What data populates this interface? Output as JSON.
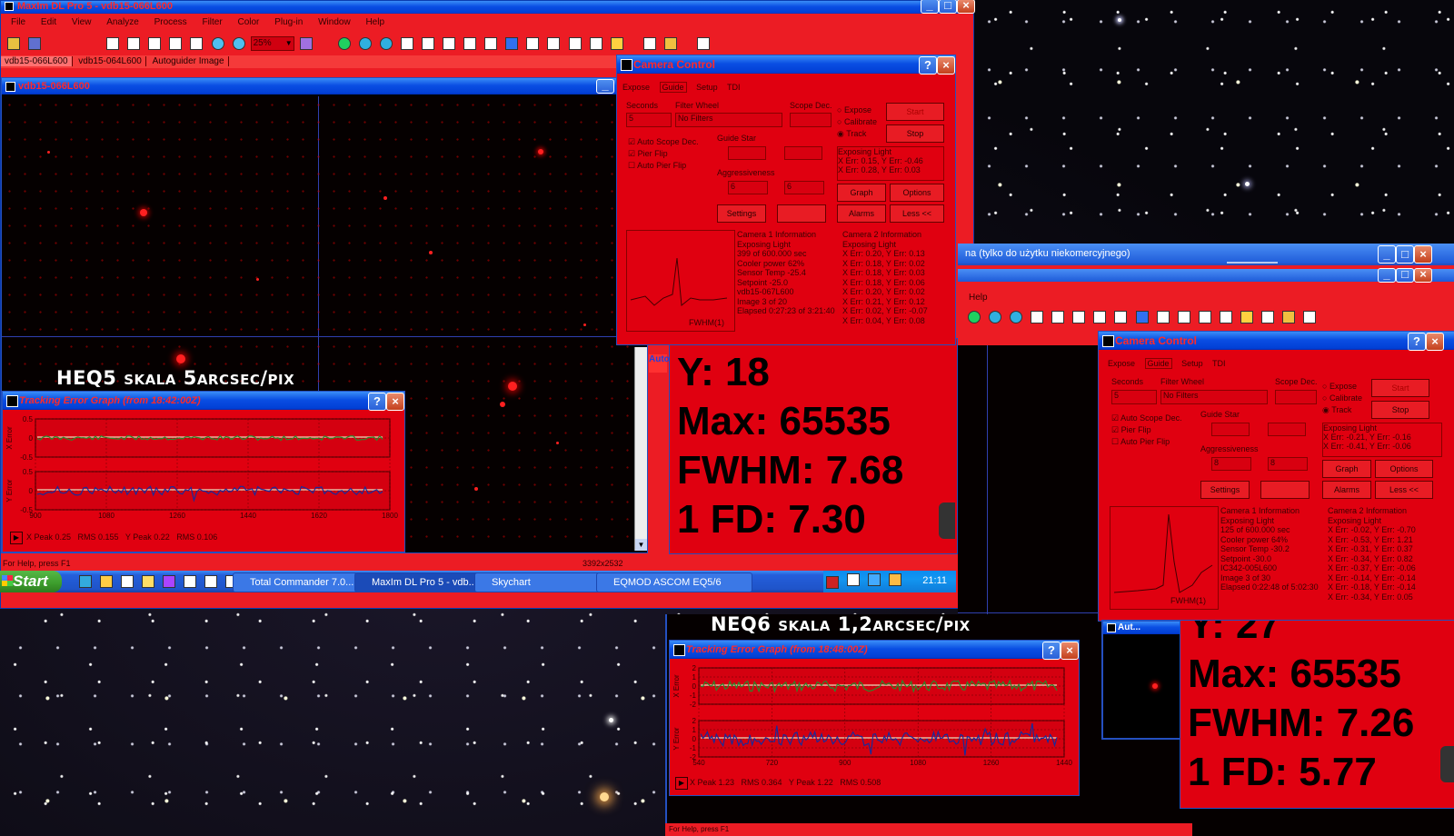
{
  "main_window": {
    "title": "MaxIm DL Pro 5 - vdb15-066L600",
    "menu": [
      "File",
      "Edit",
      "View",
      "Analyze",
      "Process",
      "Filter",
      "Color",
      "Plug-in",
      "Window",
      "Help"
    ],
    "zoom": "25%",
    "doc_tabs": [
      "vdb15-066L600",
      "vdb15-064L600",
      "Autoguider Image"
    ],
    "image_title": "vdb15-066L600",
    "status_left": "For Help, press F1",
    "status_coords": "3392x2532"
  },
  "camera_control_1": {
    "title": "Camera Control",
    "tabs": [
      "Expose",
      "Guide",
      "Setup",
      "TDI"
    ],
    "seconds_label": "Seconds",
    "seconds_value": "5",
    "filter_wheel_label": "Filter Wheel",
    "filter_value": "No Filters",
    "scope_dec_label": "Scope Dec.",
    "radios": [
      "Expose",
      "Calibrate",
      "Track"
    ],
    "start_label": "Start",
    "stop_label": "Stop",
    "checks": [
      "Auto Scope Dec.",
      "Pier Flip",
      "Auto Pier Flip"
    ],
    "guide_star_label": "Guide Star",
    "aggr_label": "Aggressiveness",
    "aggr_x": "6",
    "aggr_y": "6",
    "status_title": "Exposing Light",
    "status_line1": "X Err: 0.15, Y Err: -0.46",
    "status_line2": "X Err: 0.28, Y Err: 0.03",
    "graph_label": "Graph",
    "options_label": "Options",
    "settings_label": "Settings",
    "alarms_label": "Alarms",
    "less_label": "Less <<",
    "fwhm_label": "FWHM(1)",
    "cam1_title": "Camera 1 Information",
    "cam1_lines": [
      "Exposing Light",
      "399 of 600.000 sec",
      "Cooler power 62%",
      "Sensor Temp -25.4",
      "Setpoint -25.0",
      "vdb15-067L600",
      "Image 3 of 20",
      "Elapsed 0:27:23 of 3:21:40"
    ],
    "cam2_title": "Camera 2 Information",
    "cam2_lines": [
      "Exposing Light",
      "X Err: 0.20, Y Err: 0.13",
      "X Err: 0.18, Y Err: 0.02",
      "X Err: 0.18, Y Err: 0.03",
      "X Err: 0.18, Y Err: 0.06",
      "X Err: 0.20, Y Err: 0.02",
      "X Err: 0.21, Y Err: 0.12",
      "X Err: 0.02, Y Err: -0.07",
      "X Err: 0.04, Y Err: 0.08"
    ]
  },
  "stats_1": {
    "y": "Y: 18",
    "max": "Max: 65535",
    "fwhm": "FWHM: 7.68",
    "fd": "1 FD: 7.30",
    "side_text": "Auto"
  },
  "label_heq5": "HEQ5 skala 5arcsec/pix",
  "teg_1": {
    "title": "Tracking Error Graph (from 18:42:00Z)",
    "x_label": "X Error",
    "y_label": "Y Error",
    "x_ticks": [
      "900",
      "1080",
      "1260",
      "1440",
      "1620",
      "1800"
    ],
    "y_ticks_x": [
      "0.5",
      "0",
      "-0.5"
    ],
    "y_ticks_y": [
      "0.5",
      "0",
      "-0.5"
    ],
    "footer": "X Peak 0.25   RMS 0.155   Y Peak 0.22   RMS 0.106"
  },
  "taskbar": {
    "start": "Start",
    "tasks": [
      "Total Commander 7.0...",
      "MaxIm DL Pro 5 - vdb...",
      "Skychart",
      "EQMOD ASCOM EQ5/6"
    ],
    "clock": "21:11"
  },
  "second_window": {
    "title_fragment": "na (tylko do użytku niekomercyjnego)",
    "menu": [
      "Help"
    ]
  },
  "camera_control_2": {
    "title": "Camera Control",
    "tabs": [
      "Expose",
      "Guide",
      "Setup",
      "TDI"
    ],
    "seconds_label": "Seconds",
    "seconds_value": "5",
    "filter_wheel_label": "Filter Wheel",
    "filter_value": "No Filters",
    "scope_dec_label": "Scope Dec.",
    "radios": [
      "Expose",
      "Calibrate",
      "Track"
    ],
    "start_label": "Start",
    "stop_label": "Stop",
    "checks": [
      "Auto Scope Dec.",
      "Pier Flip",
      "Auto Pier Flip"
    ],
    "guide_star_label": "Guide Star",
    "aggr_label": "Aggressiveness",
    "aggr_x": "8",
    "aggr_y": "8",
    "status_title": "Exposing Light",
    "status_line1": "X Err: -0.21, Y Err: -0.16",
    "status_line2": "X Err: -0.41, Y Err: -0.06",
    "graph_label": "Graph",
    "options_label": "Options",
    "settings_label": "Settings",
    "alarms_label": "Alarms",
    "less_label": "Less <<",
    "fwhm_label": "FWHM(1)",
    "cam1_title": "Camera 1 Information",
    "cam1_lines": [
      "Exposing Light",
      "125 of 600.000 sec",
      "Cooler power 64%",
      "Sensor Temp -30.2",
      "Setpoint -30.0",
      "IC342-005L600",
      "Image 3 of 30",
      "Elapsed 0:22:48 of 5:02:30"
    ],
    "cam2_title": "Camera 2 Information",
    "cam2_lines": [
      "Exposing Light",
      "X Err: -0.02, Y Err: -0.70",
      "X Err: -0.53, Y Err: 1.21",
      "X Err: -0.31, Y Err: 0.37",
      "X Err: -0.34, Y Err: 0.82",
      "X Err: -0.37, Y Err: -0.06",
      "X Err: -0.14, Y Err: -0.14",
      "X Err: -0.18, Y Err: -0.14",
      "X Err: -0.34, Y Err: 0.05"
    ]
  },
  "stats_2": {
    "y": "Y: 27",
    "max": "Max: 65535",
    "fwhm": "FWHM: 7.26",
    "fd": "1 FD: 5.77",
    "auto_title": "Aut..."
  },
  "label_neq6": "NEQ6 skala 1,2arcsec/pix",
  "teg_2": {
    "title": "Tracking Error Graph (from 18:48:00Z)",
    "x_label": "X Error",
    "y_label": "Y Error",
    "x_ticks": [
      "540",
      "720",
      "900",
      "1080",
      "1260",
      "1440"
    ],
    "y_ticks_x": [
      "2",
      "1",
      "0",
      "-1",
      "-2"
    ],
    "y_ticks_y": [
      "2",
      "1",
      "0",
      "-1",
      "-2"
    ],
    "footer": "X Peak 1.23   RMS 0.364   Y Peak 1.22   RMS 0.508"
  },
  "bottom_status_2": "For Help, press F1"
}
